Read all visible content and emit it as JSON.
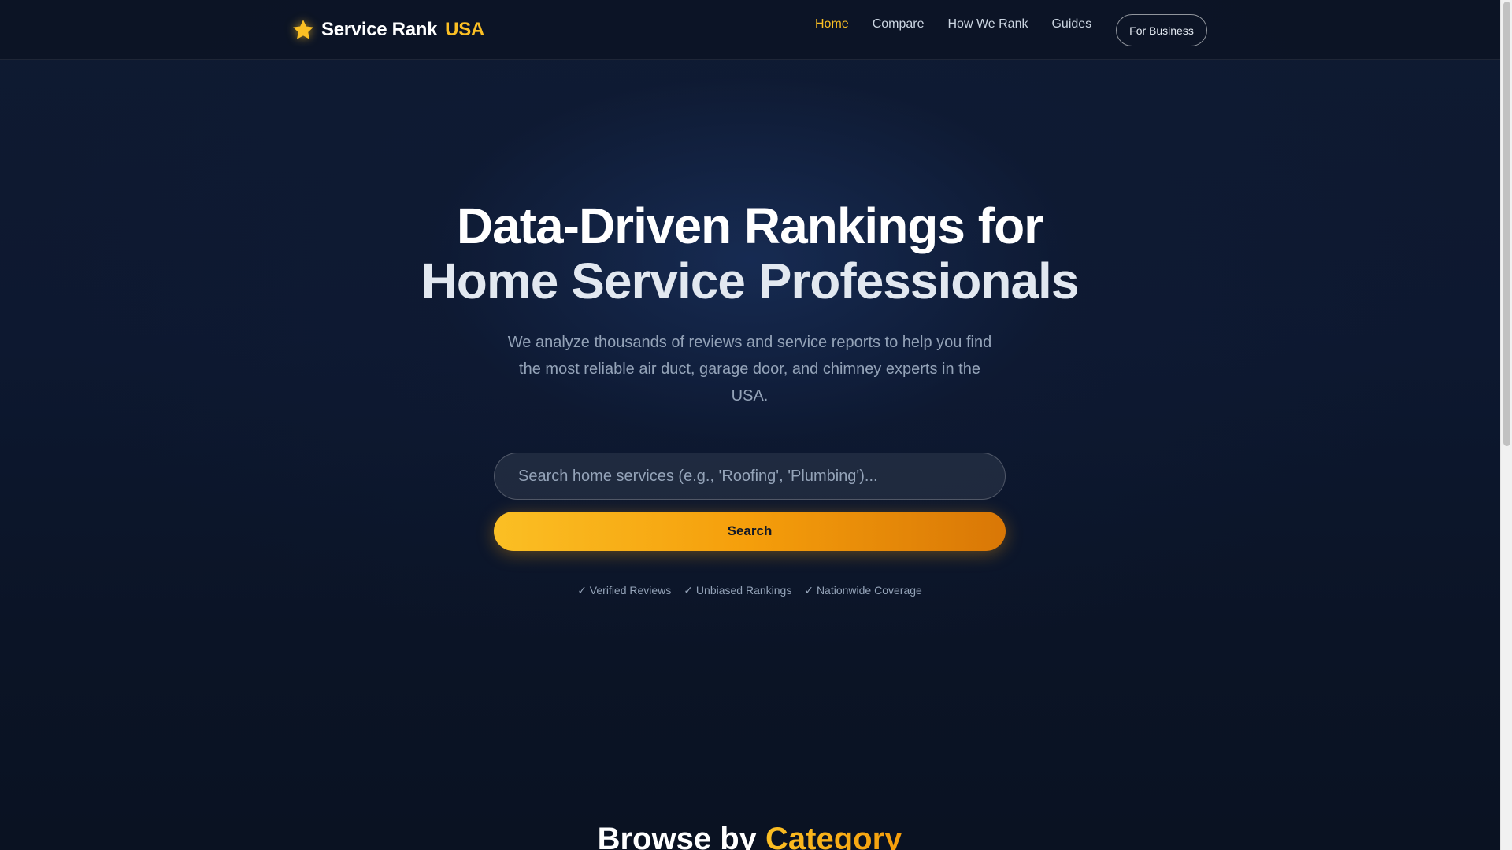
{
  "brand": {
    "name": "Service Rank",
    "accent": "USA",
    "icon": "star-icon",
    "accent_color": "#fbbf24"
  },
  "nav": {
    "items": [
      {
        "label": "Home",
        "active": true
      },
      {
        "label": "Compare",
        "active": false
      },
      {
        "label": "How We Rank",
        "active": false
      },
      {
        "label": "Guides",
        "active": false
      }
    ],
    "cta_label": "For Business"
  },
  "hero": {
    "title_line1": "Data-Driven Rankings for",
    "title_line2": "Home Service Professionals",
    "subtitle": "We analyze thousands of reviews and service reports to help you find the most reliable air duct, garage door, and chimney experts in the USA.",
    "search": {
      "placeholder": "Search home services (e.g., 'Roofing', 'Plumbing')...",
      "value": "",
      "button_label": "Search"
    },
    "badges": [
      "✓ Verified Reviews",
      "✓ Unbiased Rankings",
      "✓ Nationwide Coverage"
    ]
  },
  "browse": {
    "title_prefix": "Browse by",
    "title_accent": "Category"
  },
  "colors": {
    "background": "#0b1120",
    "accent": "#fbbf24",
    "muted_text": "#94a3b8"
  }
}
